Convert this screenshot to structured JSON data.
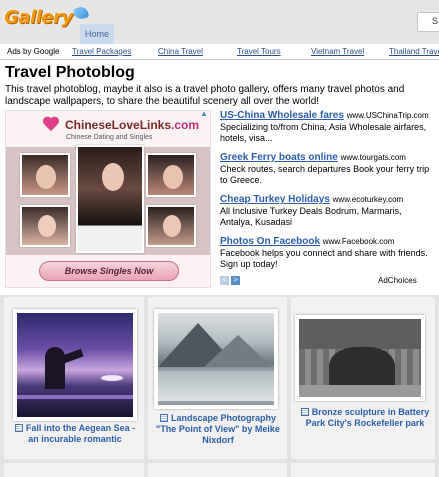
{
  "header": {
    "logo_text": "Gallery",
    "nav_home": "Home",
    "search_letter": "S"
  },
  "links_bar": {
    "ads_by": "Ads by Google",
    "links": [
      "Travel Packages",
      "China Travel",
      "Travel Tours",
      "Vietnam Travel",
      "Thailand Travel"
    ]
  },
  "page": {
    "title": "Travel Photoblog",
    "intro": "This travel photoblog, maybe it also is a travel photo gallery, offers many travel photos and landscape wallpapers, to share the beautiful scenery all over the world!"
  },
  "banner_ad": {
    "brand": "ChineseLoveLinks",
    "brand_suffix": ".com",
    "tagline": "Chinese Dating and Singles",
    "button": "Browse Singles Now"
  },
  "text_ads": [
    {
      "title": "US-China Wholesale fares",
      "url": "www.USChinaTrip.com",
      "body": "Specializing to/from China, Asia Wholesale airfares, hotels, visa..."
    },
    {
      "title": "Greek Ferry boats online",
      "url": "www.tourgats.com",
      "body": "Check routes, search departures Book your ferry trip to Greece."
    },
    {
      "title": "Cheap Turkey Holidays",
      "url": "www.ecoturkey.com",
      "body": "All Inclusive Turkey Deals Bodrum, Marmaris, Antalya, Kusadasi"
    },
    {
      "title": "Photos On Facebook",
      "url": "www.Facebook.com",
      "body": "Facebook helps you connect and share with friends. Sign up today!"
    }
  ],
  "ad_controls": {
    "prev": "<",
    "next": ">",
    "adchoices": "AdChoices"
  },
  "gallery": [
    {
      "caption": "Fall into the Aegean Sea - an incurable romantic",
      "icon": "photo-icon"
    },
    {
      "caption": "Landscape Photography \"The Point of View\" by Meike Nixdorf",
      "icon": "photo-icon"
    },
    {
      "caption": "Bronze sculpture in Battery Park City's Rockefeller park",
      "icon": "photo-icon"
    }
  ],
  "colors": {
    "link": "#2c4f91",
    "ad_title": "#2c5fa8",
    "header_bg": "#e6e6e6",
    "logo": "#f29a0e"
  }
}
